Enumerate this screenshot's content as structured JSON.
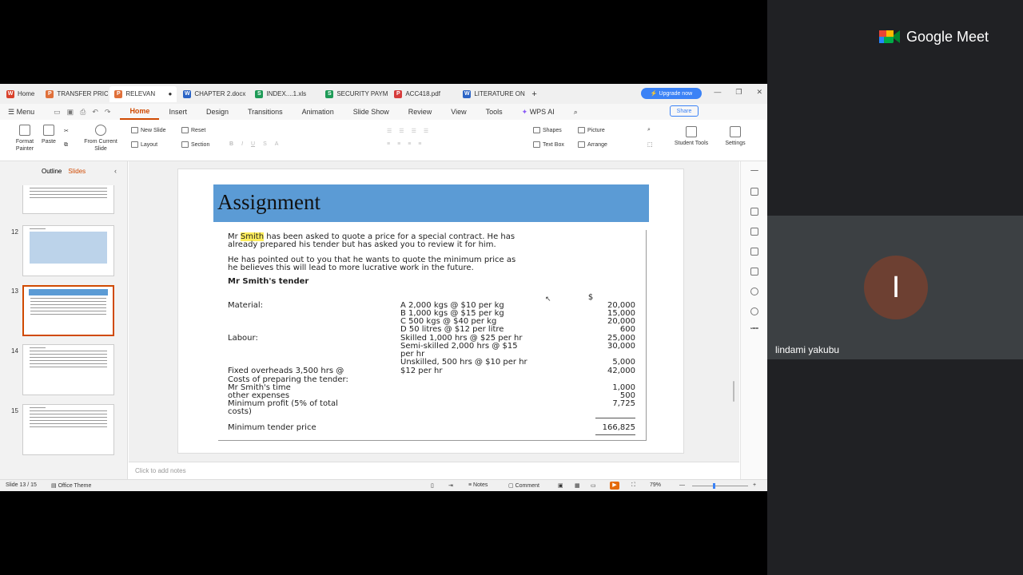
{
  "meet": {
    "brand": "Google Meet",
    "participant_name": "lindami yakubu",
    "avatar_initial": "I"
  },
  "tabs": [
    {
      "label": "Home",
      "icon": "W",
      "color": "#d9412b"
    },
    {
      "label": "TRANSFER PRICIN",
      "icon": "P",
      "color": "#e0703a"
    },
    {
      "label": "RELEVAN",
      "icon": "P",
      "color": "#e0703a"
    },
    {
      "label": "CHAPTER 2.docx",
      "icon": "W",
      "color": "#2b64c6"
    },
    {
      "label": "INDEX....1.xls",
      "icon": "S",
      "color": "#1e9b57"
    },
    {
      "label": "SECURITY PAYMEN",
      "icon": "S",
      "color": "#1e9b57"
    },
    {
      "label": "ACC418.pdf",
      "icon": "P",
      "color": "#d63b3b"
    },
    {
      "label": "LITERATURE ON V",
      "icon": "W",
      "color": "#2b64c6"
    }
  ],
  "topbar": {
    "upgrade": "Upgrade now",
    "new_tab": "+"
  },
  "menu": {
    "menu": "Menu",
    "items": [
      "Home",
      "Insert",
      "Design",
      "Transitions",
      "Animation",
      "Slide Show",
      "Review",
      "View",
      "Tools",
      "WPS AI"
    ],
    "share": "Share"
  },
  "ribbon": {
    "format_painter": "Format Painter",
    "paste": "Paste",
    "from_current": "From Current Slide",
    "new_slide": "New Slide",
    "reset": "Reset",
    "layout": "Layout",
    "section": "Section",
    "shapes": "Shapes",
    "picture": "Picture",
    "text_box": "Text Box",
    "arrange": "Arrange",
    "student_tools": "Student Tools",
    "settings": "Settings"
  },
  "side": {
    "outline": "Outline",
    "slides": "Slides",
    "numbers": [
      "12",
      "13",
      "14",
      "15"
    ],
    "add": "+"
  },
  "slide": {
    "title": "Assignment",
    "p1_pre": "Mr ",
    "p1_name": "Smith",
    "p1_rest": " has been asked to quote a price for a special contract. He has",
    "p1_line2": "already prepared his tender but has asked you to review it for him.",
    "p2_line1": "He has pointed out to you that he wants to quote the minimum price as",
    "p2_line2": "he believes this will lead to more lucrative work in the future.",
    "heading": "Mr Smith's tender",
    "currency": "$",
    "material_label": "Material:",
    "labour_label": "Labour:",
    "rows": [
      {
        "desc": "A 2,000 kgs @ $10 per kg",
        "amount": "20,000"
      },
      {
        "desc": "B 1,000 kgs @ $15 per kg",
        "amount": "15,000"
      },
      {
        "desc": "C 500 kgs @ $40 per kg",
        "amount": "20,000"
      },
      {
        "desc": "D 50 litres @ $12 per litre",
        "amount": "600"
      },
      {
        "desc": "Skilled 1,000 hrs @ $25 per hr",
        "amount": "25,000"
      },
      {
        "desc": "Semi-skilled 2,000 hrs @ $15",
        "amount": "30,000"
      },
      {
        "desc": "per hr",
        "amount": ""
      },
      {
        "desc": "Unskilled, 500 hrs @ $10 per hr",
        "amount": "5,000"
      }
    ],
    "fixed_label": "Fixed overheads 3,500 hrs @",
    "fixed_rate": "$12 per hr",
    "fixed_amount": "42,000",
    "costs_label": "Costs of preparing the tender:",
    "time_label": "Mr Smith's time",
    "time_amount": "1,000",
    "other_label": "other expenses",
    "other_amount": "500",
    "profit_label": "Minimum profit (5% of total",
    "profit_label2": "costs)",
    "profit_amount": "7,725",
    "total_label": "Minimum tender price",
    "total_amount": "166,825"
  },
  "notes_placeholder": "Click to add notes",
  "status": {
    "slide": "Slide 13 / 15",
    "theme": "Office Theme",
    "notes": "Notes",
    "comment": "Comment",
    "zoom": "79%"
  }
}
